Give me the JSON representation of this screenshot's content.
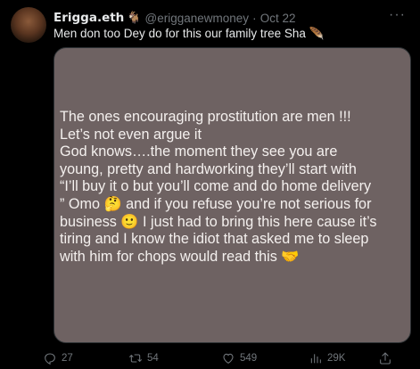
{
  "tweet": {
    "author_name": "Erigga.eth",
    "author_emoji": "🐐",
    "handle": "@erigganewmoney",
    "separator": "·",
    "date": "Oct 22",
    "more_label": "···",
    "text": "Men don too Dey do for this our family tree Sha 🪶"
  },
  "image_text": {
    "lines": [
      "The ones encouraging prostitution are men !!!",
      "Let’s not even argue it",
      "God knows….the moment they see you are",
      "young, pretty and hardworking they’ll start with",
      "“I’ll buy it o but you’ll come and do home delivery",
      "” Omo 🤔 and if you refuse you’re not serious for",
      "business 🙂 I just had to bring this here cause it’s",
      "tiring and I know the idiot that asked me to sleep",
      "with him for chops would read this 🤝"
    ]
  },
  "actions": {
    "replies": "27",
    "reposts": "54",
    "likes": "549",
    "views": "29K"
  },
  "colors": {
    "background": "#000000",
    "text": "#e7e9ea",
    "muted": "#71767b",
    "image_bg": "#6e6262"
  }
}
